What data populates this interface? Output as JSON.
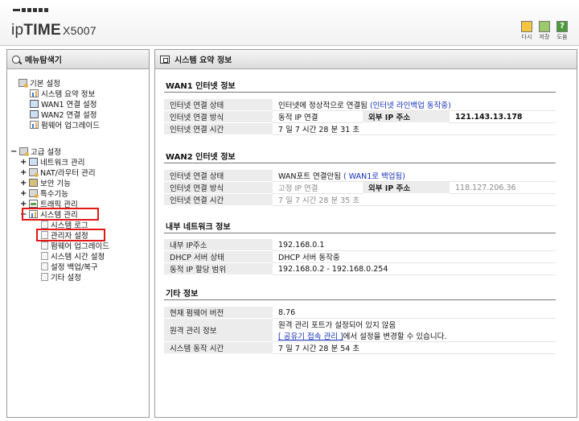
{
  "header": {
    "logo_prefix": "ip",
    "logo_bold": "TIME",
    "logo_model": "X5007",
    "buttons": [
      {
        "label": "다시",
        "icon": "refresh-icon",
        "color": "#f5c542"
      },
      {
        "label": "저장",
        "icon": "save-icon",
        "color": "#9bc96a"
      },
      {
        "label": "도움",
        "icon": "help-icon",
        "color": "#4b9b3a",
        "glyph": "?"
      }
    ]
  },
  "sidebar": {
    "title": "메뉴탐색기",
    "basic": {
      "label": "기본 설정",
      "items": [
        "시스템 요약 정보",
        "WAN1 연결 설정",
        "WAN2 연결 설정",
        "펌웨어 업그레이드"
      ]
    },
    "advanced": {
      "label": "고급 설정",
      "items": [
        "네트워크 관리",
        "NAT/라우터 관리",
        "보안 기능",
        "특수기능",
        "트래픽 관리",
        "시스템 관리"
      ],
      "system_children": [
        "시스템 로그",
        "관리자 설정",
        "펌웨어 업그레이드",
        "시스템 시간 설정",
        "설정 백업/복구",
        "기타 설정"
      ]
    },
    "highlight_color": "#e21818"
  },
  "main": {
    "title": "시스템 요약 정보",
    "wan1": {
      "title": "WAN1 인터넷 정보",
      "status_key": "인터넷 연결 상태",
      "status_value": "인터넷에 정상적으로 연결됨",
      "status_link": "(인터넷 라인백업 동작중)",
      "method_key": "인터넷 연결 방식",
      "method_value": "동적 IP 연결",
      "ext_ip_key": "외부 IP 주소",
      "ext_ip_value": "121.143.13.178",
      "time_key": "인터넷 연결 시간",
      "time_value": "7 일 7 시간 28 분 31 초"
    },
    "wan2": {
      "title": "WAN2 인터넷 정보",
      "status_key": "인터넷 연결 상태",
      "status_value": "WAN포트 연결안됨",
      "status_link": "( WAN1로 백업됨)",
      "method_key": "인터넷 연결 방식",
      "method_value": "고정 IP 연결",
      "ext_ip_key": "외부 IP 주소",
      "ext_ip_value": "118.127.206.36",
      "time_key": "인터넷 연결 시간",
      "time_value": "7 일 7 시간 28 분 35 초"
    },
    "lan": {
      "title": "내부 네트워크 정보",
      "ip_key": "내부 IP주소",
      "ip_value": "192.168.0.1",
      "dhcp_key": "DHCP 서버 상태",
      "dhcp_value": "DHCP 서버 동작중",
      "range_key": "동적 IP 할당 범위",
      "range_value": "192.168.0.2 - 192.168.0.254"
    },
    "etc": {
      "title": "기타 정보",
      "fw_key": "현재 펌웨어 버전",
      "fw_value": "8.76",
      "remote_key": "원격 관리 정보",
      "remote_line1": "원격 관리 포트가 설정되어 있지 않음",
      "remote_link": "[ 공유기 접속 관리 ]",
      "remote_line2": "에서 설정을 변경할 수 있습니다.",
      "uptime_key": "시스템 동작 시간",
      "uptime_value": "7 일 7 시간 28 분 54 초"
    }
  }
}
